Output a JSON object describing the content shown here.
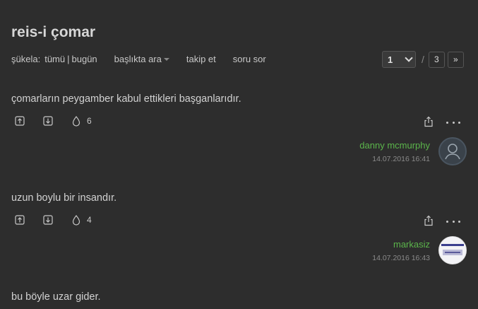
{
  "topic": {
    "title": "reis-i çomar"
  },
  "subnav": {
    "sukela_label": "şükela:",
    "sukela_all": "tümü",
    "separator": "|",
    "sukela_today": "bugün",
    "search_label": "başlıkta ara",
    "follow_label": "takip et",
    "ask_label": "soru sor"
  },
  "pager": {
    "current": "1",
    "separator": "/",
    "total": "3",
    "next": "»"
  },
  "entries": [
    {
      "text": "çomarların peygamber kabul ettikleri başganlarıdır.",
      "favorites": "6",
      "author": "danny mcmurphy",
      "date": "14.07.2016 16:41"
    },
    {
      "text": "uzun boylu bir insandır.",
      "favorites": "4",
      "author": "markasiz",
      "date": "14.07.2016 16:43"
    },
    {
      "text": "bu böyle uzar gider."
    }
  ],
  "colors": {
    "background": "#2d2d2d",
    "author": "#5bb54b",
    "text": "#d2d2d2"
  },
  "icons": [
    "upvote-icon",
    "downvote-icon",
    "drop-icon",
    "share-icon",
    "more-icon",
    "default-avatar-icon"
  ]
}
